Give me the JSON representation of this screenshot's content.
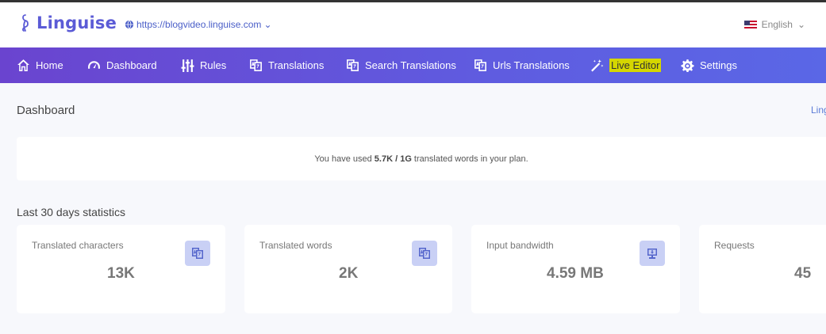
{
  "header": {
    "brand": "Linguise",
    "site_url": "https://blogvideo.linguise.com",
    "language": "English"
  },
  "nav": {
    "items": [
      {
        "label": "Home",
        "icon": "home-icon"
      },
      {
        "label": "Dashboard",
        "icon": "gauge-icon"
      },
      {
        "label": "Rules",
        "icon": "sliders-icon"
      },
      {
        "label": "Translations",
        "icon": "translate-icon"
      },
      {
        "label": "Search Translations",
        "icon": "translate-icon"
      },
      {
        "label": "Urls Translations",
        "icon": "translate-icon"
      },
      {
        "label": "Live Editor",
        "icon": "magic-wand-icon"
      },
      {
        "label": "Settings",
        "icon": "gear-icon"
      }
    ]
  },
  "main": {
    "title": "Dashboard",
    "top_link": "Ling",
    "usage": {
      "prefix": "You have used ",
      "used": "5.7K / 1G",
      "suffix": " translated words in your plan."
    },
    "stats_title": "Last 30 days statistics",
    "cards": [
      {
        "label": "Translated characters",
        "value": "13K",
        "icon": "translate-icon"
      },
      {
        "label": "Translated words",
        "value": "2K",
        "icon": "translate-icon"
      },
      {
        "label": "Input bandwidth",
        "value": "4.59 MB",
        "icon": "download-monitor-icon"
      },
      {
        "label": "Requests",
        "value": "45",
        "icon": ""
      }
    ]
  },
  "colors": {
    "nav_start": "#6a44cf",
    "nav_end": "#5a67e6",
    "brand": "#5b5bd6",
    "highlight": "#d5d600"
  }
}
